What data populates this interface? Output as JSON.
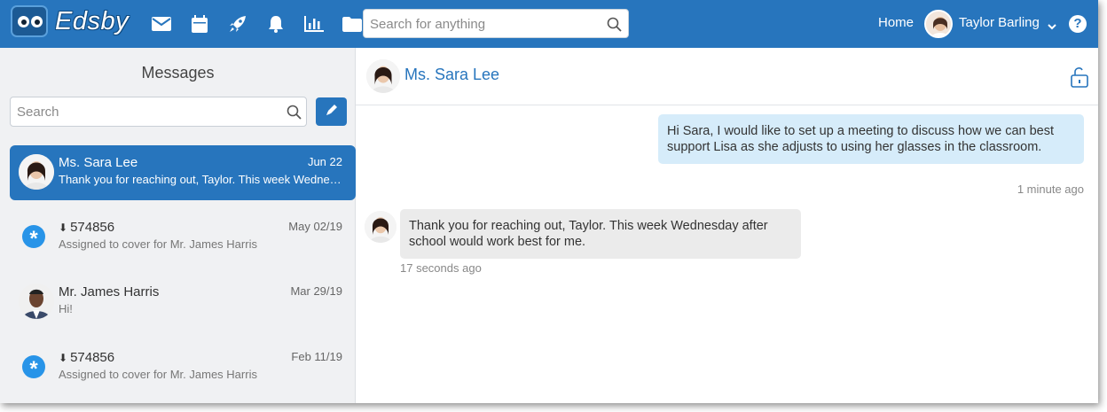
{
  "app": {
    "name": "Edsby"
  },
  "topbar": {
    "nav_icons": [
      "mail-icon",
      "calendar-icon",
      "rocket-icon",
      "bell-icon",
      "chart-icon",
      "folder-icon"
    ],
    "search_placeholder": "Search for anything",
    "home_label": "Home",
    "user_name": "Taylor Barling",
    "help_label": "?"
  },
  "sidebar": {
    "title": "Messages",
    "search_placeholder": "Search",
    "conversations": [
      {
        "name": "Ms. Sara Lee",
        "date": "Jun 22",
        "preview": "Thank you for reaching out, Taylor. This week Wednesday after school would work best for me.",
        "active": true
      },
      {
        "name": "574856",
        "date": "May 02/19",
        "preview": "Assigned to cover for Mr. James Harris"
      },
      {
        "name": "Mr. James Harris",
        "date": "Mar 29/19",
        "preview": "Hi!"
      },
      {
        "name": "574856",
        "date": "Feb 11/19",
        "preview": "Assigned to cover for Mr. James Harris"
      }
    ]
  },
  "conversation": {
    "title": "Ms. Sara Lee",
    "messages": [
      {
        "direction": "out",
        "text": "Hi Sara, I would like to set up a meeting to discuss how we can best support Lisa as she adjusts to using her glasses in the classroom.",
        "time": "1 minute ago"
      },
      {
        "direction": "in",
        "text": "Thank you for reaching out, Taylor. This week Wednesday after school would work best for me.",
        "time": "17 seconds ago"
      }
    ]
  },
  "colors": {
    "brand": "#2775bd",
    "outgoing_bubble": "#d6ecfa",
    "incoming_bubble": "#ebebeb",
    "sidebar_bg": "#f0f1f3"
  }
}
